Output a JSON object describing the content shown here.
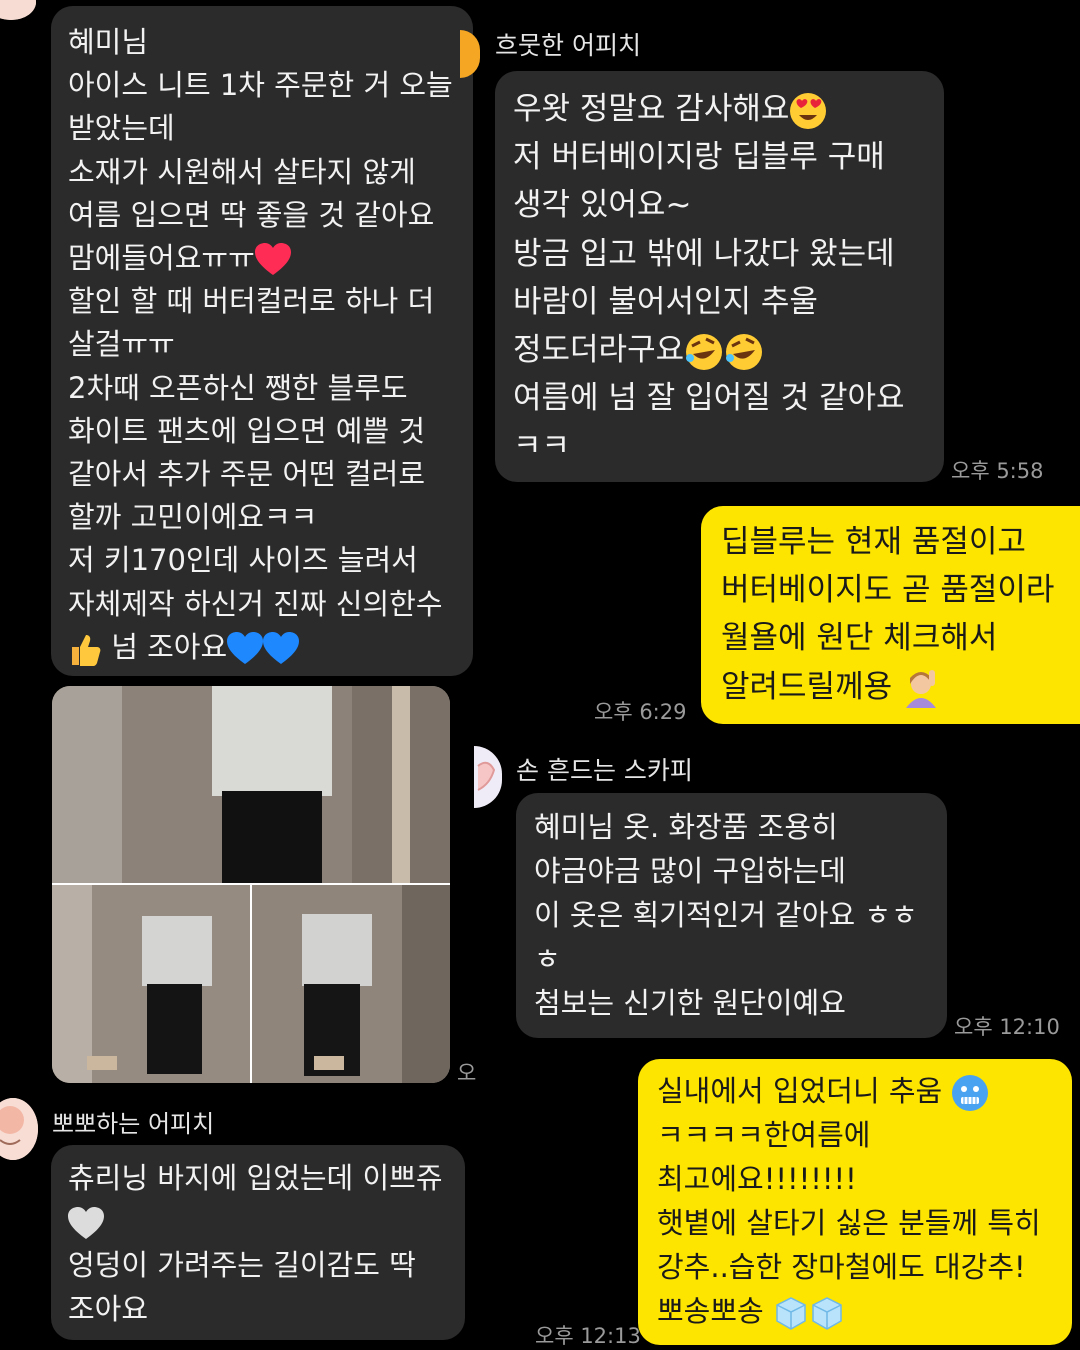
{
  "left_column": {
    "message1": {
      "lines": [
        "혜미님",
        "아이스 니트 1차 주문한 거 오늘",
        "받았는데",
        "소재가 시원해서 살타지 않게",
        "여름 입으면 딱 좋을 것 같아요",
        "맘에들어요ㅠㅠ",
        "할인 할 때 버터컬러로 하나 더",
        "살걸ㅠㅠ",
        "2차때 오픈하신 쨍한 블루도",
        "화이트 팬츠에 입으면 예쁠 것",
        "같아서 추가 주문 어떤 컬러로",
        "할까 고민이에요ㅋㅋ",
        "저 키170인데 사이즈 늘려서",
        "자체제작 하신거 진짜 신의한수",
        " 넘 조아요"
      ]
    },
    "photo_time_partial": "오",
    "message2": {
      "sender": "뽀뽀하는 어피치",
      "lines": [
        "츄리닝 바지에 입었는데 이쁘쥬",
        "",
        "엉덩이 가려주는 길이감도 딱",
        "조아요"
      ]
    }
  },
  "right_column": {
    "message1": {
      "sender": "흐뭇한 어피치",
      "lines": [
        "우왓 정말요 감사해요",
        "저 버터베이지랑 딥블루 구매",
        "생각 있어요~",
        "방금 입고 밖에 나갔다 왔는데",
        "바람이 불어서인지 추울",
        "정도더라구요",
        "여름에 넘 잘 입어질 것 같아요",
        "ㅋㅋ"
      ],
      "time": "오후 5:58"
    },
    "reply1": {
      "lines": [
        "딥블루는 현재 품절이고",
        "버터베이지도 곧 품절이라",
        "월욜에 원단 체크해서",
        "알려드릴께용 "
      ],
      "time": "오후 6:29"
    },
    "message2": {
      "sender": "손 흔드는 스카피",
      "lines": [
        "혜미님 옷. 화장품 조용히",
        "야금야금 많이 구입하는데",
        "이 옷은 획기적인거 같아요 ㅎㅎ",
        "ㅎ",
        "첨보는 신기한 원단이예요"
      ],
      "time": "오후 12:10"
    },
    "reply2": {
      "lines": [
        "실내에서 입었더니 추움 ",
        "ㅋㅋㅋㅋ한여름에",
        "최고에요!!!!!!!!",
        "햇볕에 살타기 싫은 분들께 특히",
        "강추..습한 장마철에도 대강추!",
        "뽀송뽀송 "
      ],
      "time": "오후 12:13"
    }
  },
  "icons": {
    "heart_eyes": "heart-eyes-emoji",
    "red_heart": "red-heart-emoji",
    "thumbs_up": "thumbs-up-emoji",
    "blue_heart": "blue-heart-emoji",
    "rofl": "rofl-emoji",
    "woman_raising_hand": "woman-raising-hand-emoji",
    "cold_face": "cold-face-emoji",
    "ice_cube": "ice-cube-emoji",
    "white_heart": "white-heart-emoji"
  },
  "colors": {
    "background": "#000000",
    "dark_bubble": "#2b2b2b",
    "yellow_bubble": "#fee500",
    "time_text": "#9a9a9a"
  }
}
